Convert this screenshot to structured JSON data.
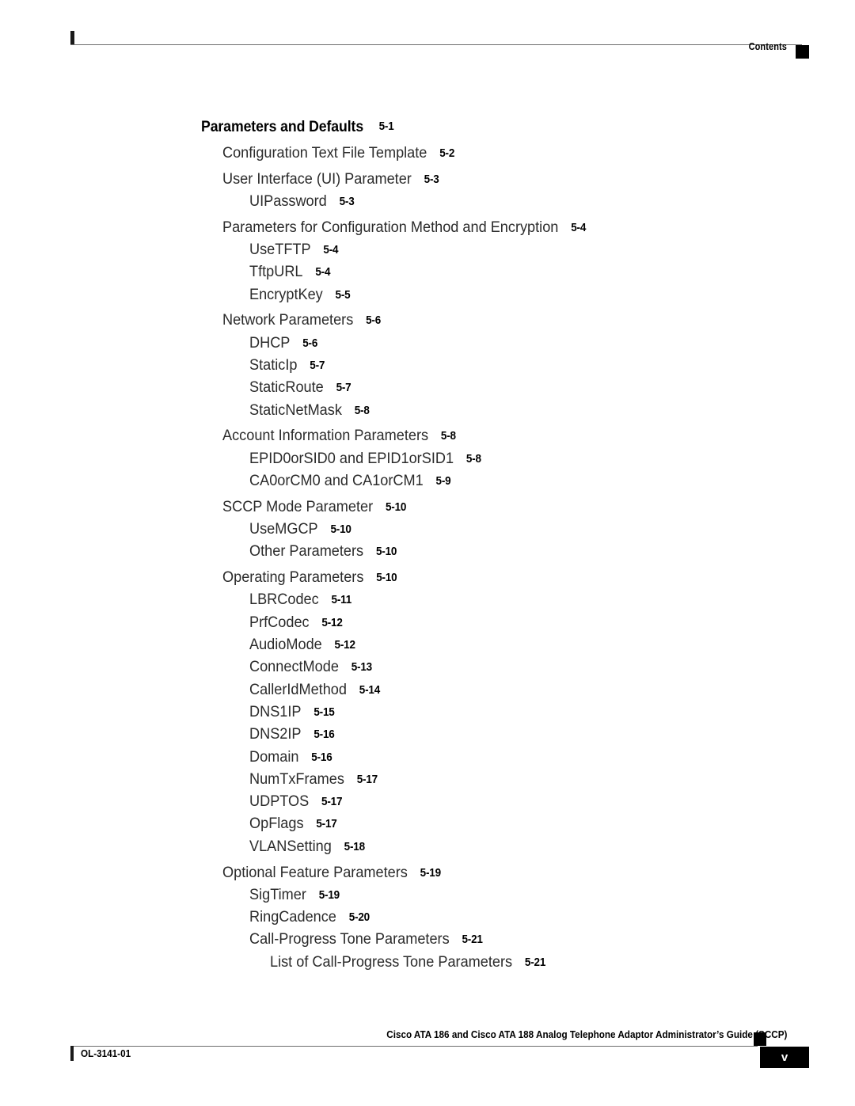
{
  "header": {
    "label": "Contents",
    "marker_color": "#000000",
    "rule_color": "#6d6d6d"
  },
  "toc": {
    "entries": [
      {
        "level": 0,
        "title": "Parameters and Defaults",
        "page": "5-1",
        "new_group": false
      },
      {
        "level": 1,
        "title": "Configuration Text File Template",
        "page": "5-2",
        "new_group": true
      },
      {
        "level": 1,
        "title": "User Interface (UI) Parameter",
        "page": "5-3",
        "new_group": true
      },
      {
        "level": 2,
        "title": "UIPassword",
        "page": "5-3",
        "new_group": false
      },
      {
        "level": 1,
        "title": "Parameters for Configuration Method and Encryption",
        "page": "5-4",
        "new_group": true
      },
      {
        "level": 2,
        "title": "UseTFTP",
        "page": "5-4",
        "new_group": false
      },
      {
        "level": 2,
        "title": "TftpURL",
        "page": "5-4",
        "new_group": false
      },
      {
        "level": 2,
        "title": "EncryptKey",
        "page": "5-5",
        "new_group": false
      },
      {
        "level": 1,
        "title": "Network Parameters",
        "page": "5-6",
        "new_group": true
      },
      {
        "level": 2,
        "title": "DHCP",
        "page": "5-6",
        "new_group": false
      },
      {
        "level": 2,
        "title": "StaticIp",
        "page": "5-7",
        "new_group": false
      },
      {
        "level": 2,
        "title": "StaticRoute",
        "page": "5-7",
        "new_group": false
      },
      {
        "level": 2,
        "title": "StaticNetMask",
        "page": "5-8",
        "new_group": false
      },
      {
        "level": 1,
        "title": "Account Information Parameters",
        "page": "5-8",
        "new_group": true
      },
      {
        "level": 2,
        "title": "EPID0orSID0 and EPID1orSID1",
        "page": "5-8",
        "new_group": false
      },
      {
        "level": 2,
        "title": "CA0orCM0 and CA1orCM1",
        "page": "5-9",
        "new_group": false
      },
      {
        "level": 1,
        "title": "SCCP Mode Parameter",
        "page": "5-10",
        "new_group": true
      },
      {
        "level": 2,
        "title": "UseMGCP",
        "page": "5-10",
        "new_group": false
      },
      {
        "level": 2,
        "title": "Other Parameters",
        "page": "5-10",
        "new_group": false
      },
      {
        "level": 1,
        "title": "Operating Parameters",
        "page": "5-10",
        "new_group": true
      },
      {
        "level": 2,
        "title": "LBRCodec",
        "page": "5-11",
        "new_group": false
      },
      {
        "level": 2,
        "title": "PrfCodec",
        "page": "5-12",
        "new_group": false
      },
      {
        "level": 2,
        "title": "AudioMode",
        "page": "5-12",
        "new_group": false
      },
      {
        "level": 2,
        "title": "ConnectMode",
        "page": "5-13",
        "new_group": false
      },
      {
        "level": 2,
        "title": "CallerIdMethod",
        "page": "5-14",
        "new_group": false
      },
      {
        "level": 2,
        "title": "DNS1IP",
        "page": "5-15",
        "new_group": false
      },
      {
        "level": 2,
        "title": "DNS2IP",
        "page": "5-16",
        "new_group": false
      },
      {
        "level": 2,
        "title": "Domain",
        "page": "5-16",
        "new_group": false
      },
      {
        "level": 2,
        "title": "NumTxFrames",
        "page": "5-17",
        "new_group": false
      },
      {
        "level": 2,
        "title": "UDPTOS",
        "page": "5-17",
        "new_group": false
      },
      {
        "level": 2,
        "title": "OpFlags",
        "page": "5-17",
        "new_group": false
      },
      {
        "level": 2,
        "title": "VLANSetting",
        "page": "5-18",
        "new_group": false
      },
      {
        "level": 1,
        "title": "Optional Feature Parameters",
        "page": "5-19",
        "new_group": true
      },
      {
        "level": 2,
        "title": "SigTimer",
        "page": "5-19",
        "new_group": false
      },
      {
        "level": 2,
        "title": "RingCadence",
        "page": "5-20",
        "new_group": false
      },
      {
        "level": 2,
        "title": "Call-Progress Tone Parameters",
        "page": "5-21",
        "new_group": false
      },
      {
        "level": 3,
        "title": "List of Call-Progress Tone Parameters",
        "page": "5-21",
        "new_group": false
      }
    ]
  },
  "footer": {
    "title": "Cisco ATA 186 and Cisco ATA 188 Analog Telephone Adaptor Administrator’s Guide (SCCP)",
    "doc_id": "OL-3141-01",
    "page_number": "v",
    "marker_color": "#000000",
    "rule_color": "#6d6d6d"
  }
}
